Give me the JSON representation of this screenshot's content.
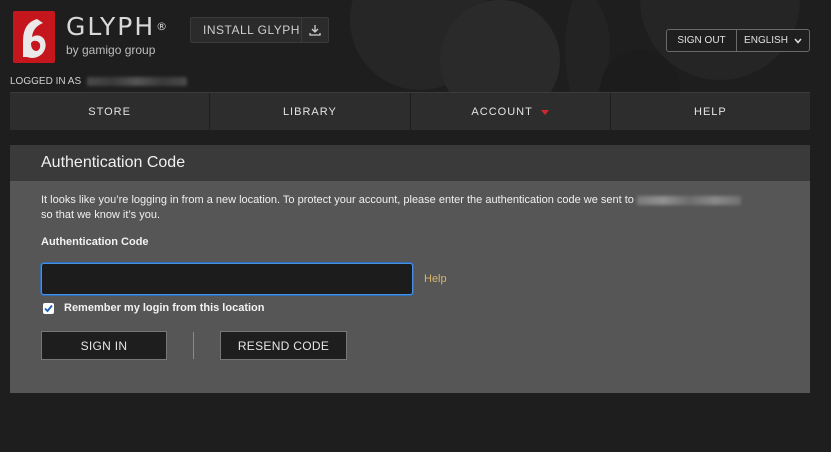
{
  "header": {
    "brand_name": "GLYPH",
    "brand_reg": "®",
    "brand_sub": "by gamigo group",
    "install_label": "INSTALL GLYPH",
    "signout_label": "SIGN OUT",
    "language_label": "ENGLISH"
  },
  "session": {
    "logged_in_label": "LOGGED IN AS"
  },
  "nav": {
    "items": [
      {
        "label": "STORE"
      },
      {
        "label": "LIBRARY"
      },
      {
        "label": "ACCOUNT"
      },
      {
        "label": "HELP"
      }
    ]
  },
  "auth": {
    "title": "Authentication Code",
    "description_1": "It looks like you’re logging in from a new location. To protect your account, please enter the authentication code we sent to",
    "description_2": "so that we know it’s you.",
    "field_label": "Authentication Code",
    "input_value": "",
    "help_label": "Help",
    "remember_label": "Remember my login from this location",
    "remember_checked": true,
    "signin_label": "SIGN IN",
    "resend_label": "RESEND CODE"
  },
  "colors": {
    "accent_red": "#d0262c",
    "help_gold": "#d8b46a",
    "focus_blue": "#4a90e2"
  },
  "icons": {
    "logo": "glyph-logo",
    "install": "download-icon",
    "language_caret": "chevron-down-icon",
    "account_caret": "caret-down-icon",
    "checkbox": "check-icon"
  }
}
